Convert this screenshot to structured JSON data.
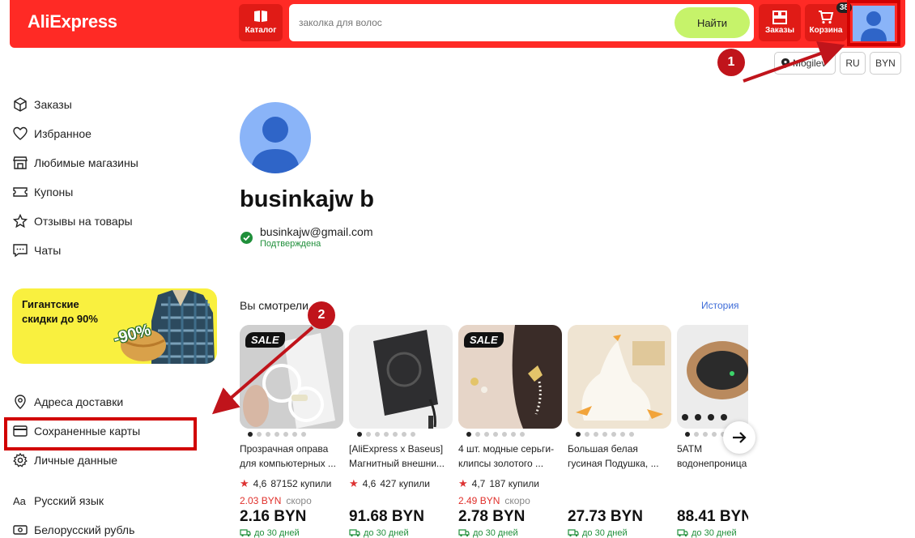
{
  "header": {
    "logo": "AliExpress",
    "catalog_label": "Каталог",
    "search_placeholder": "заколка для волос",
    "search_button": "Найти",
    "orders_label": "Заказы",
    "cart_label": "Корзина",
    "cart_count": "38"
  },
  "subheader": {
    "location": "Mogilev",
    "language": "RU",
    "currency": "BYN"
  },
  "sidebar": {
    "items": [
      {
        "label": "Заказы",
        "icon": "box-icon"
      },
      {
        "label": "Избранное",
        "icon": "heart-icon"
      },
      {
        "label": "Любимые магазины",
        "icon": "store-icon"
      },
      {
        "label": "Купоны",
        "icon": "coupon-icon"
      },
      {
        "label": "Отзывы на товары",
        "icon": "star-icon"
      },
      {
        "label": "Чаты",
        "icon": "chat-icon"
      }
    ],
    "promo": {
      "line1": "Гигантские",
      "line2": "скидки до 90%",
      "badge": "-90%"
    },
    "items2": [
      {
        "label": "Адреса доставки",
        "icon": "location-pin-icon"
      },
      {
        "label": "Сохраненные карты",
        "icon": "card-icon"
      },
      {
        "label": "Личные данные",
        "icon": "gear-icon"
      },
      {
        "label": "Русский язык",
        "icon": "language-icon"
      },
      {
        "label": "Белорусский рубль",
        "icon": "currency-icon"
      }
    ]
  },
  "profile": {
    "name": "businkajw b",
    "email": "businkajw@gmail.com",
    "status": "Подтверждена"
  },
  "viewed": {
    "title": "Вы смотрели",
    "history_link": "История",
    "items": [
      {
        "name": "Прозрачная оправа\nдля компьютерных ...",
        "rating": "4,6",
        "sold": "87152 купили",
        "old_price": "2.03 BYN",
        "note": "скоро",
        "price": "2.16 BYN",
        "delivery": "до 30 дней",
        "sale": "SALE"
      },
      {
        "name": "[AliExpress x Baseus]\nМагнитный внешни...",
        "rating": "4,6",
        "sold": "427 купили",
        "old_price": "",
        "note": "",
        "price": "91.68 BYN",
        "delivery": "до 30 дней",
        "sale": ""
      },
      {
        "name": "4 шт. модные серьги-\nклипсы золотого ...",
        "rating": "4,7",
        "sold": "187 купили",
        "old_price": "2.49 BYN",
        "note": "скоро",
        "price": "2.78 BYN",
        "delivery": "до 30 дней",
        "sale": "SALE"
      },
      {
        "name": "Большая белая\nгусиная Подушка, ...",
        "rating": "",
        "sold": "",
        "old_price": "",
        "note": "",
        "price": "27.73 BYN",
        "delivery": "до 30 дней",
        "sale": ""
      },
      {
        "name": "5ATM\nводонепроница",
        "rating": "",
        "sold": "",
        "old_price": "",
        "note": "",
        "price": "88.41 BYN",
        "delivery": "до 30 дней",
        "sale": ""
      }
    ]
  },
  "annotations": {
    "marker1": "1",
    "marker2": "2",
    "color": "#c0141b"
  }
}
